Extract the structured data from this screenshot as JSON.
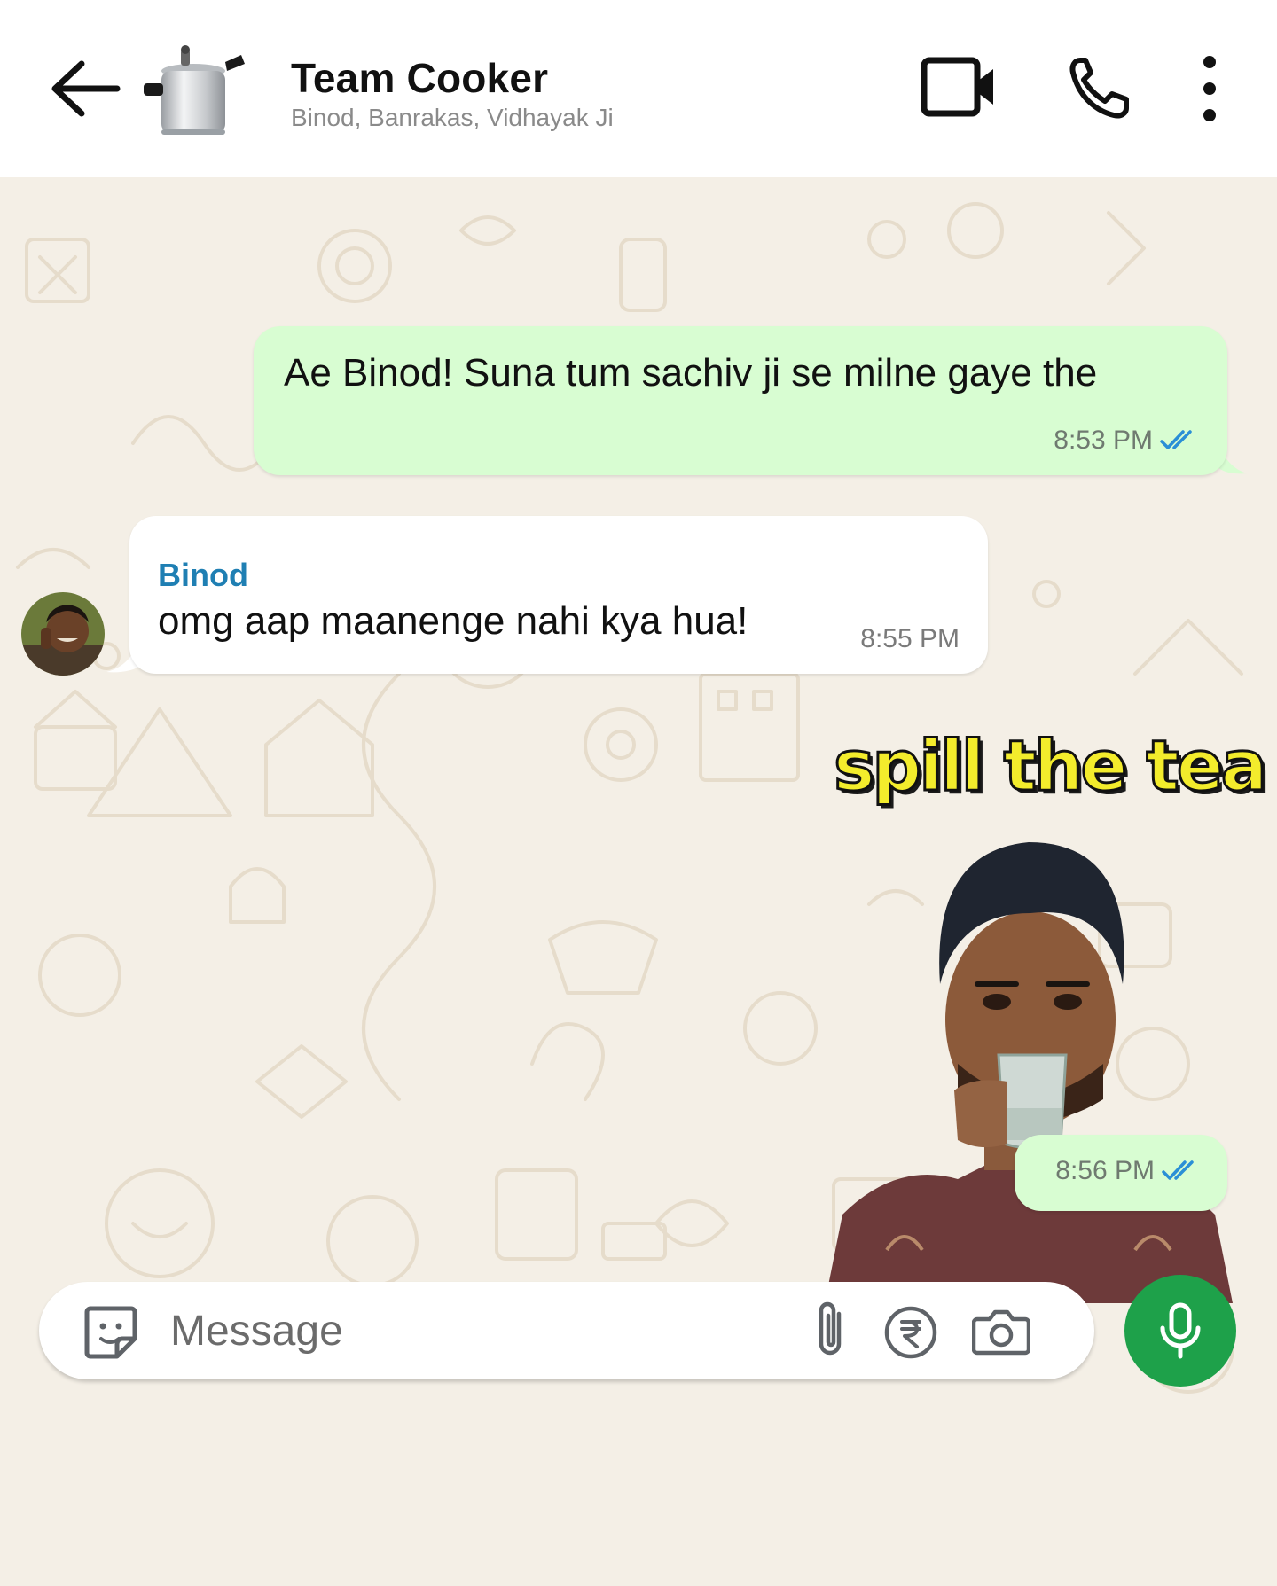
{
  "header": {
    "title": "Team Cooker",
    "members": "Binod, Banrakas, Vidhayak Ji",
    "icons": {
      "back": "arrow-left-icon",
      "video": "video-camera-icon",
      "call": "phone-icon",
      "more": "more-vertical-icon"
    }
  },
  "messages": [
    {
      "direction": "outgoing",
      "text": "Ae Binod! Suna tum sachiv ji se milne gaye the",
      "time": "8:53 PM",
      "status": "read"
    },
    {
      "direction": "incoming",
      "sender": "Binod",
      "text": "omg aap maanenge nahi kya hua!",
      "time": "8:55 PM"
    },
    {
      "direction": "outgoing",
      "type": "sticker",
      "sticker_text": "spill the tea",
      "time": "8:56 PM",
      "status": "read"
    }
  ],
  "composer": {
    "placeholder": "Message",
    "icons": {
      "emoji": "sticker-icon",
      "attach": "paperclip-icon",
      "payment": "rupee-icon",
      "camera": "camera-icon",
      "mic": "microphone-icon"
    }
  },
  "colors": {
    "outgoing_bubble": "#d8fdd2",
    "incoming_bubble": "#ffffff",
    "chat_background": "#f4efe6",
    "sender_name": "#1f7fb3",
    "read_ticks": "#2a8fd6",
    "mic_button": "#1ea14a"
  }
}
